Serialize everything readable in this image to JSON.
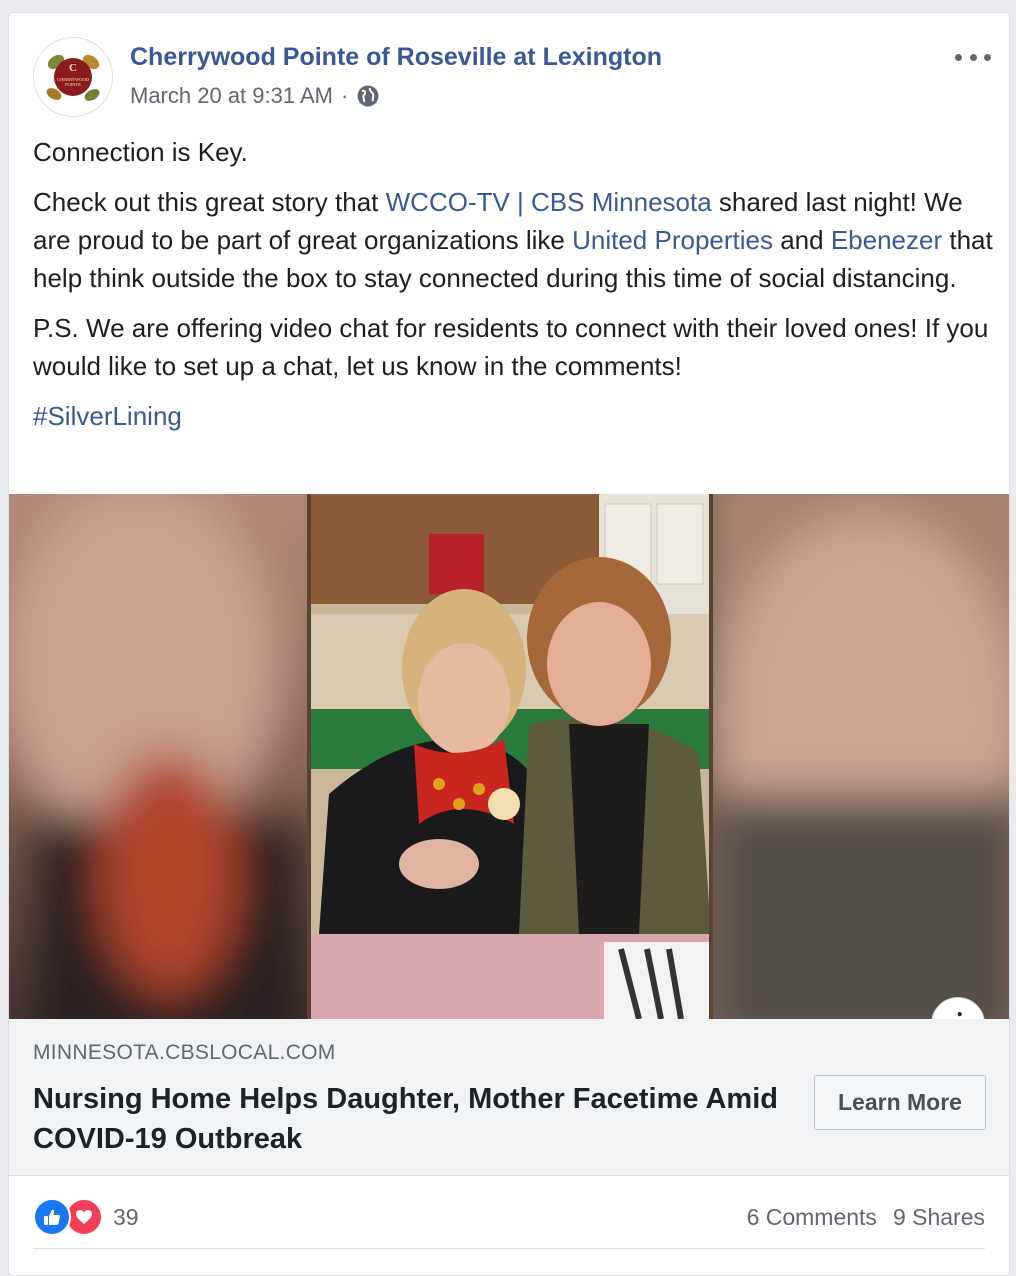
{
  "post": {
    "page_name": "Cherrywood Pointe of Roseville at Lexington",
    "timestamp": "March 20 at 9:31 AM",
    "separator": "·",
    "avatar_logo_text": "CHERRYWOOD POINTE",
    "privacy_icon": "globe-icon",
    "more_icon": "ellipsis-icon"
  },
  "body": {
    "line1": "Connection is Key.",
    "p2_a": "Check out this great story that ",
    "p2_link1": "WCCO-TV | CBS Minnesota",
    "p2_b": " shared last night! We are proud to be part of great organizations like ",
    "p2_link2": "United Properties",
    "p2_c": " and ",
    "p2_link3": "Ebenezer",
    "p2_d": " that help think outside the box to stay connected during this time of social distancing.",
    "p3": "P.S. We are offering video chat for residents to connect with their loved ones! If you would like to set up a chat, let us know in the comments!",
    "hashtag": "#SilverLining"
  },
  "link_preview": {
    "domain": "MINNESOTA.CBSLOCAL.COM",
    "headline": "Nursing Home Helps Daughter, Mother Facetime Amid COVID-19 Outbreak",
    "cta": "Learn More",
    "info_glyph": "i"
  },
  "engagement": {
    "reaction_count": "39",
    "comments": "6 Comments",
    "shares": "9 Shares"
  },
  "colors": {
    "link": "#385898",
    "like": "#1877f2",
    "love": "#f33e58"
  }
}
